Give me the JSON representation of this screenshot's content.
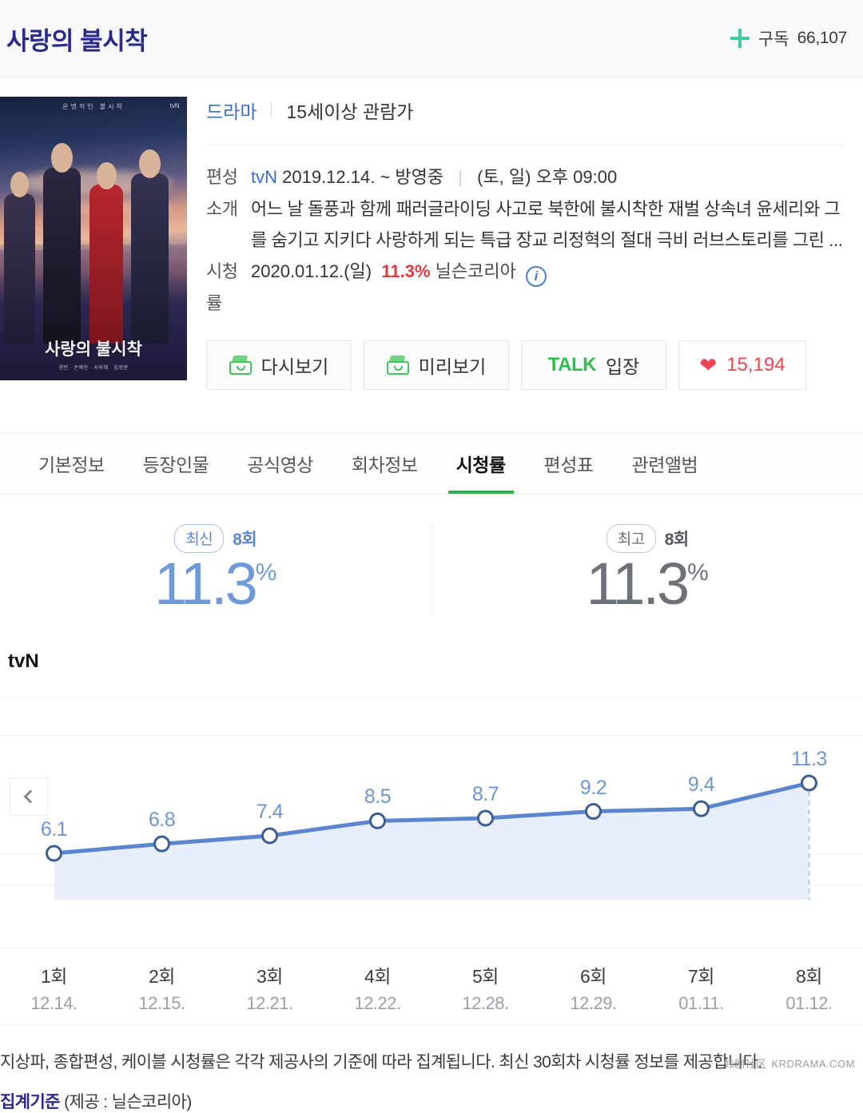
{
  "header": {
    "title": "사랑의 불시착",
    "subscribe_label": "구독",
    "subscribe_count": "66,107",
    "plus_icon": "plus-icon",
    "accent": "#3fc9a4",
    "title_color": "#2a2a8c"
  },
  "poster": {
    "title": "사랑의 불시착",
    "top_text": "운명적인 불시착",
    "network_badge": "tvN",
    "credits": "현빈 · 손예진 · 서지혜 · 김정현"
  },
  "info": {
    "genre": "드라마",
    "age_rating": "15세이상 관람가",
    "rows": [
      {
        "label": "편성",
        "channel": "tvN",
        "schedule": "2019.12.14. ~ 방영중",
        "airtime": "(토, 일) 오후 09:00"
      },
      {
        "label": "소개",
        "line1": "어느 날 돌풍과 함께 패러글라이딩 사고로 북한에 불시착한 재벌 상속녀 윤세리와 그",
        "line2": "를 숨기고 지키다 사랑하게 되는 특급 장교 리정혁의 절대 극비 러브스토리를 그린 ..."
      },
      {
        "label": "시청률",
        "date": "2020.01.12.(일)",
        "percent": "11.3%",
        "provider": "닐슨코리아",
        "info_icon": "info-circle-icon"
      }
    ]
  },
  "actions": [
    {
      "label": "다시보기",
      "icon": "tv-box-icon"
    },
    {
      "label": "미리보기",
      "icon": "tv-box-icon"
    },
    {
      "brand": "TALK",
      "label": "입장",
      "icon": "talk-icon"
    },
    {
      "label": "15,194",
      "icon": "heart-icon"
    }
  ],
  "tabs": [
    {
      "label": "기본정보",
      "active": false
    },
    {
      "label": "등장인물",
      "active": false
    },
    {
      "label": "공식영상",
      "active": false
    },
    {
      "label": "회차정보",
      "active": false
    },
    {
      "label": "시청률",
      "active": true
    },
    {
      "label": "편성표",
      "active": false
    },
    {
      "label": "관련앨범",
      "active": false
    }
  ],
  "summary": {
    "latest": {
      "chip": "최신",
      "episode": "8회",
      "value": "11.3",
      "unit": "%"
    },
    "highest": {
      "chip": "최고",
      "episode": "8회",
      "value": "11.3",
      "unit": "%"
    }
  },
  "chart_section": {
    "channel": "tvN",
    "prev_button_icon": "chevron-left-icon"
  },
  "chart_data": {
    "type": "line",
    "title": "tvN 시청률",
    "xlabel": "",
    "ylabel": "",
    "ylim": [
      0,
      12
    ],
    "grid": true,
    "legend": "none",
    "categories": [
      "1회",
      "2회",
      "3회",
      "4회",
      "5회",
      "6회",
      "7회",
      "8회"
    ],
    "x_sublabels": [
      "12.14.",
      "12.15.",
      "12.21.",
      "12.22.",
      "12.28.",
      "12.29.",
      "01.11.",
      "01.12."
    ],
    "values": [
      6.1,
      6.8,
      7.4,
      8.5,
      8.7,
      9.2,
      9.4,
      11.3
    ],
    "point_labels": [
      "6.1",
      "6.8",
      "7.4",
      "8.5",
      "8.7",
      "9.2",
      "9.4",
      "11.3"
    ],
    "series": [
      {
        "name": "tvN",
        "values": [
          6.1,
          6.8,
          7.4,
          8.5,
          8.7,
          9.2,
          9.4,
          11.3
        ]
      }
    ],
    "line_color": "#5b86cf",
    "fill_color": "#e8eefb",
    "marker_fill": "#ffffff",
    "label_color": "#6d95cf"
  },
  "footer": {
    "note": "지상파, 종합편성, 케이블 시청률은 각각 제공사의 기준에 따라 집계됩니다. 최신 30회차 시청률 정보를 제공합니다.",
    "criteria_link": "집계기준",
    "criteria_provider": "(제공 : 닐슨코리아)"
  },
  "watermark": {
    "cn": "韩剧社区",
    "site": "KRDRAMA.COM"
  }
}
